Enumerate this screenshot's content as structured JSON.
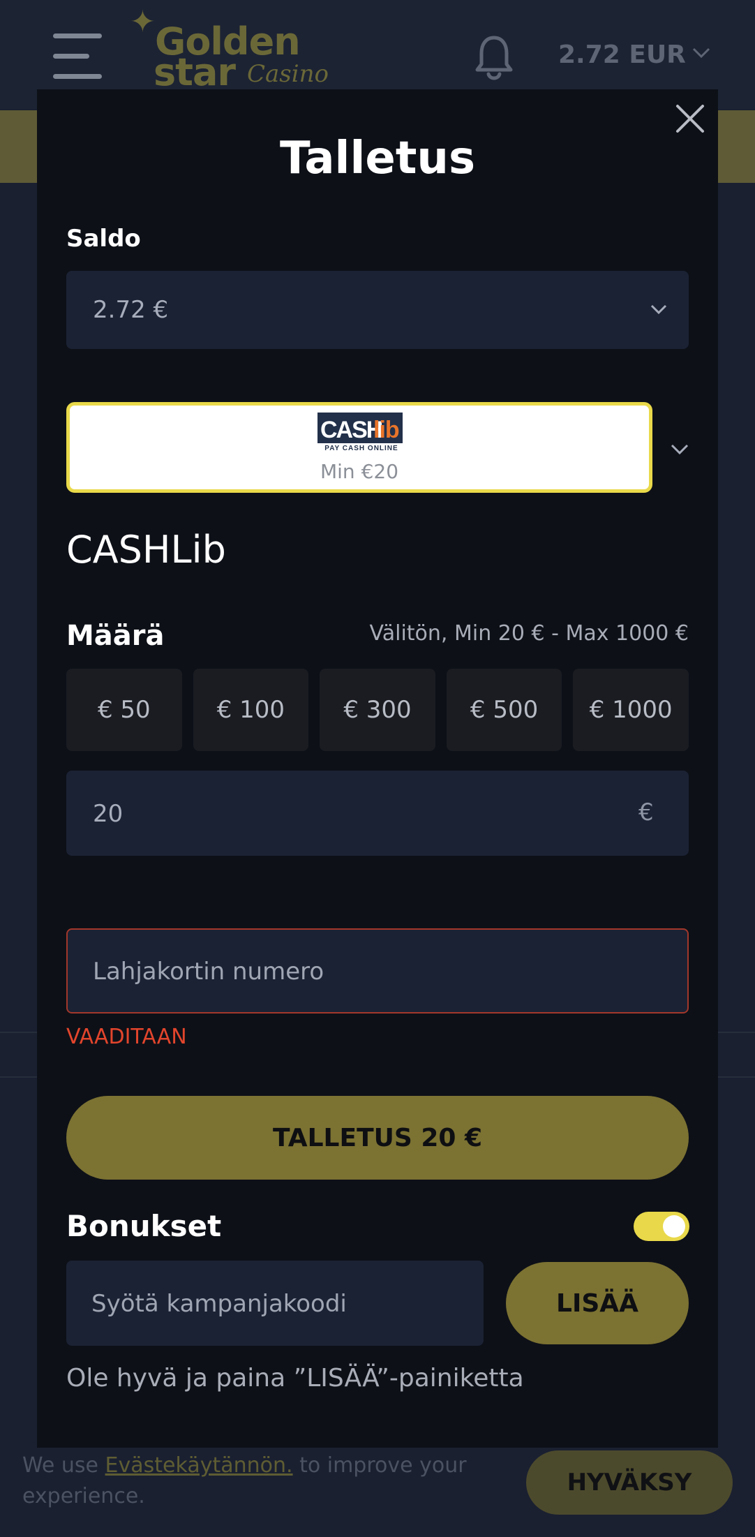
{
  "header": {
    "logo_word1": "Golden",
    "logo_word2": "star",
    "logo_word3": "Casino",
    "balance": "2.72 EUR",
    "icons": [
      "menu-icon",
      "bell-icon",
      "chevron-down-icon"
    ]
  },
  "modal": {
    "title": "Talletus",
    "saldo_label": "Saldo",
    "saldo_value": "2.72 €",
    "method": {
      "logo_text_1": "CASH",
      "logo_text_2": "lib",
      "logo_tagline": "PAY CASH ONLINE",
      "min_text": "Min €20",
      "name": "CASHLib"
    },
    "amount_label": "Määrä",
    "amount_hint": "Välitön, Min 20 € - Max 1000 €",
    "presets": [
      "€ 50",
      "€ 100",
      "€ 300",
      "€ 500",
      "€ 1000"
    ],
    "amount_value": "20",
    "currency_symbol": "€",
    "gift_card_placeholder": "Lahjakortin numero",
    "required_text": "VAADITAAN",
    "deposit_button": "TALLETUS 20 €",
    "bonus_label": "Bonukset",
    "bonus_toggle_on": true,
    "promo_placeholder": "Syötä kampanjakoodi",
    "add_button": "LISÄÄ",
    "promo_help": "Ole hyvä ja paina ”LISÄÄ”-painiketta"
  },
  "cookie": {
    "text_before": "We use ",
    "link": "Evästekäytännön.",
    "text_after": " to improve your experience.",
    "accept_button": "HYVÄKSY"
  },
  "colors": {
    "accent_yellow": "#e8d84a",
    "button_olive": "#7c7232",
    "error_red": "#e2452c",
    "modal_bg": "#0d1017",
    "input_bg": "#1b2234"
  }
}
